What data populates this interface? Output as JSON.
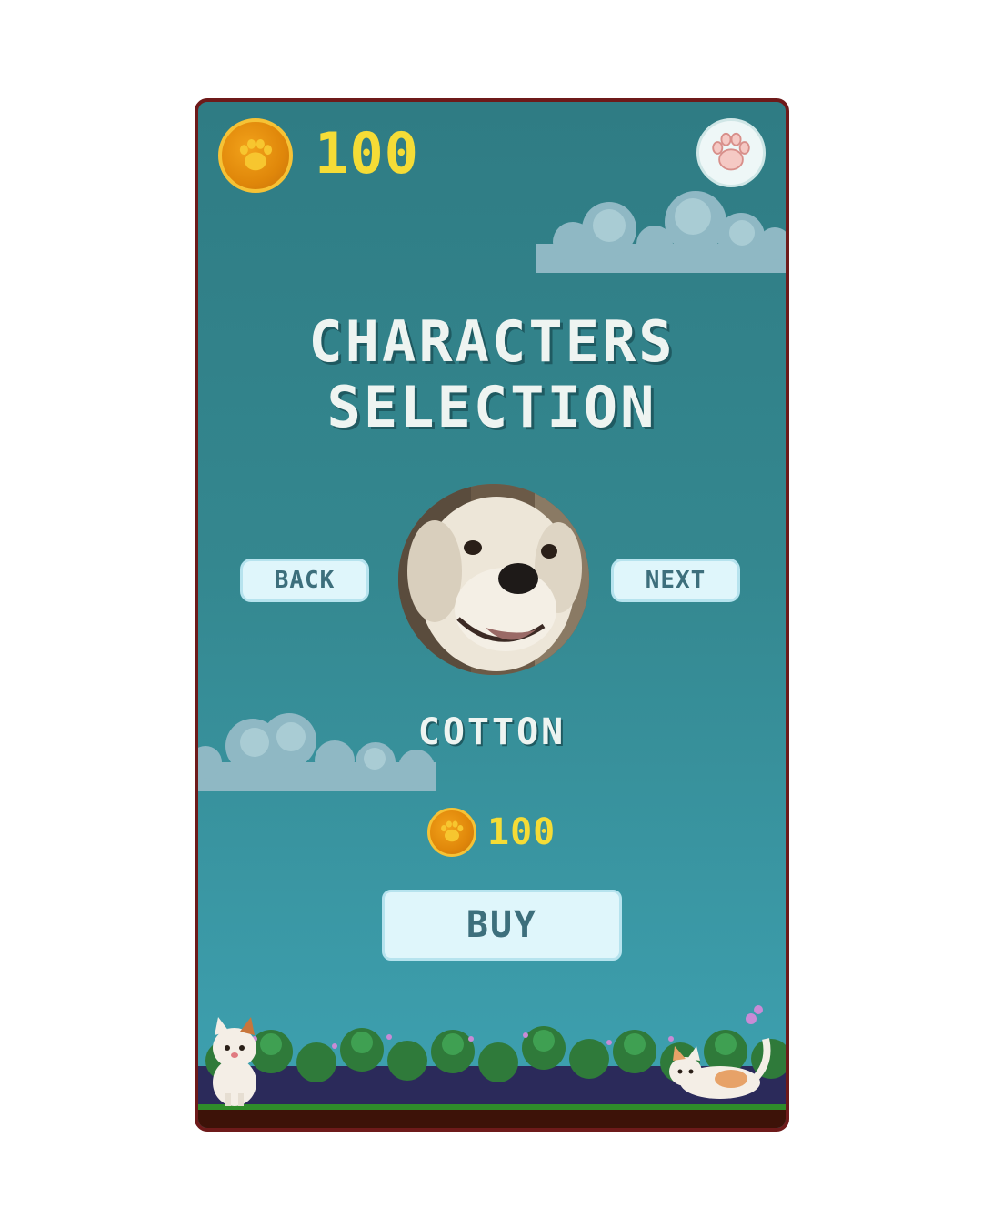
{
  "header": {
    "coin_icon": "paw-coin-icon",
    "coin_balance": "100",
    "menu_icon": "paw-icon"
  },
  "title": {
    "line1": "CHARACTERS",
    "line2": "SELECTION"
  },
  "navigation": {
    "back_label": "BACK",
    "next_label": "NEXT"
  },
  "character": {
    "name": "COTTON",
    "portrait": "white-dog-portrait",
    "price": "100",
    "price_icon": "paw-coin-icon"
  },
  "actions": {
    "buy_label": "BUY"
  },
  "colors": {
    "frame": "#6e1a1a",
    "background_top": "#2f7c84",
    "background_bottom": "#3ea2b2",
    "coin_text": "#f5dc36",
    "button_bg": "#dff6fb",
    "button_text": "#3d6f7c"
  }
}
